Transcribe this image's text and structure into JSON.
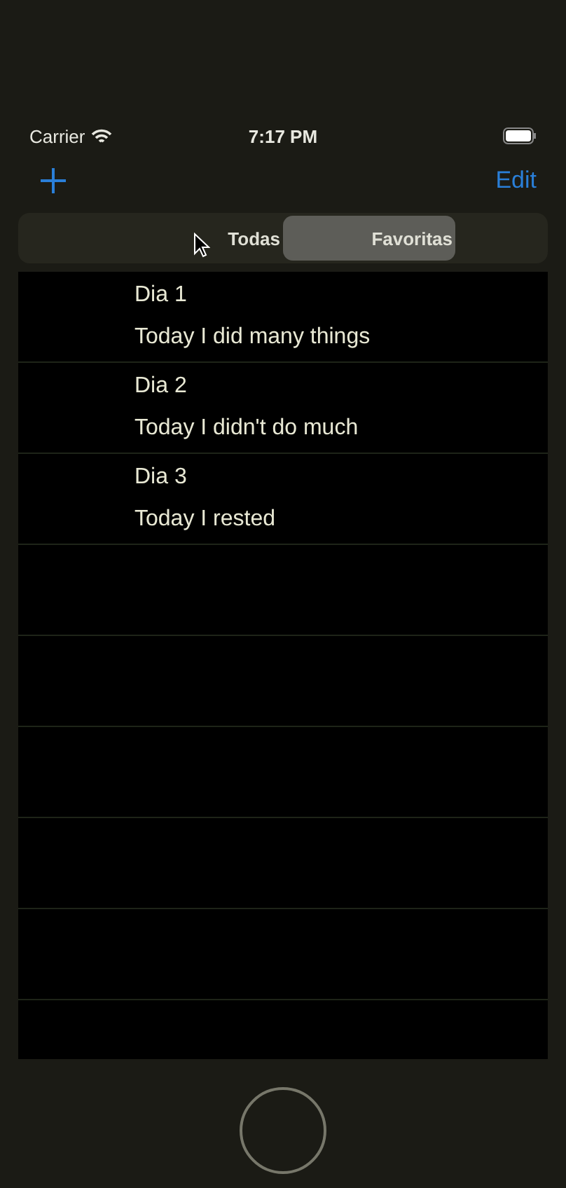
{
  "status_bar": {
    "carrier": "Carrier",
    "time": "7:17 PM"
  },
  "nav": {
    "edit": "Edit"
  },
  "segments": [
    {
      "label": "Todas",
      "selected": false
    },
    {
      "label": "Favoritas",
      "selected": true
    }
  ],
  "entries": [
    {
      "title": "Dia 1",
      "text": "Today I did many things"
    },
    {
      "title": "Dia 2",
      "text": "Today I didn't do much"
    },
    {
      "title": "Dia 3",
      "text": "Today I rested"
    }
  ]
}
